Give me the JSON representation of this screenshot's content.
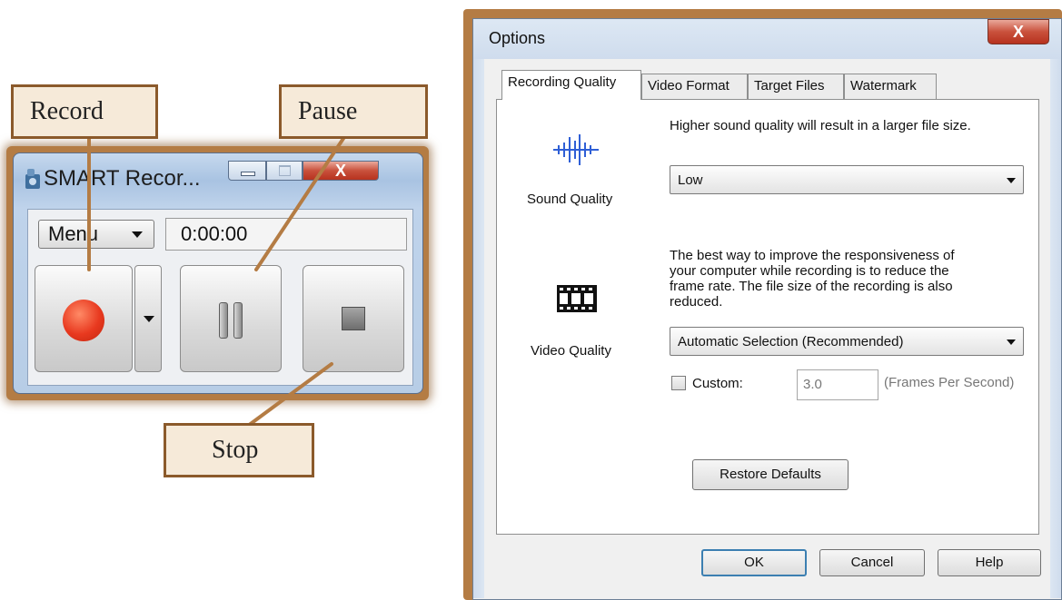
{
  "callouts": {
    "record": "Record",
    "pause": "Pause",
    "stop": "Stop"
  },
  "recorder": {
    "title": "SMART Recor...",
    "menu_label": "Menu",
    "time": "0:00:00",
    "icons": [
      "app-icon",
      "minimize-icon",
      "maximize-icon",
      "close-icon",
      "record-icon",
      "dropdown-arrow-icon",
      "pause-icon",
      "stop-icon"
    ],
    "close_glyph": "X",
    "colors": {
      "frame": "#b47c44",
      "record": "#e8391f",
      "close": "#c9513c"
    }
  },
  "options": {
    "title": "Options",
    "close_glyph": "X",
    "tabs": [
      "Recording Quality",
      "Video Format",
      "Target Files",
      "Watermark"
    ],
    "active_tab": "Recording Quality",
    "sound": {
      "description": "Higher sound quality will result in a larger file size.",
      "label": "Sound Quality",
      "selected": "Low"
    },
    "video": {
      "description_lines": [
        "The best way to improve the responsiveness of",
        "your computer while recording is to reduce the",
        "frame rate.  The file size of the recording is also",
        "reduced."
      ],
      "label": "Video Quality",
      "selected": "Automatic Selection (Recommended)",
      "custom_label": "Custom:",
      "custom_checked": false,
      "fps_value": "3.0",
      "fps_unit": "(Frames Per Second)"
    },
    "restore_defaults": "Restore Defaults",
    "buttons": {
      "ok": "OK",
      "cancel": "Cancel",
      "help": "Help"
    }
  }
}
